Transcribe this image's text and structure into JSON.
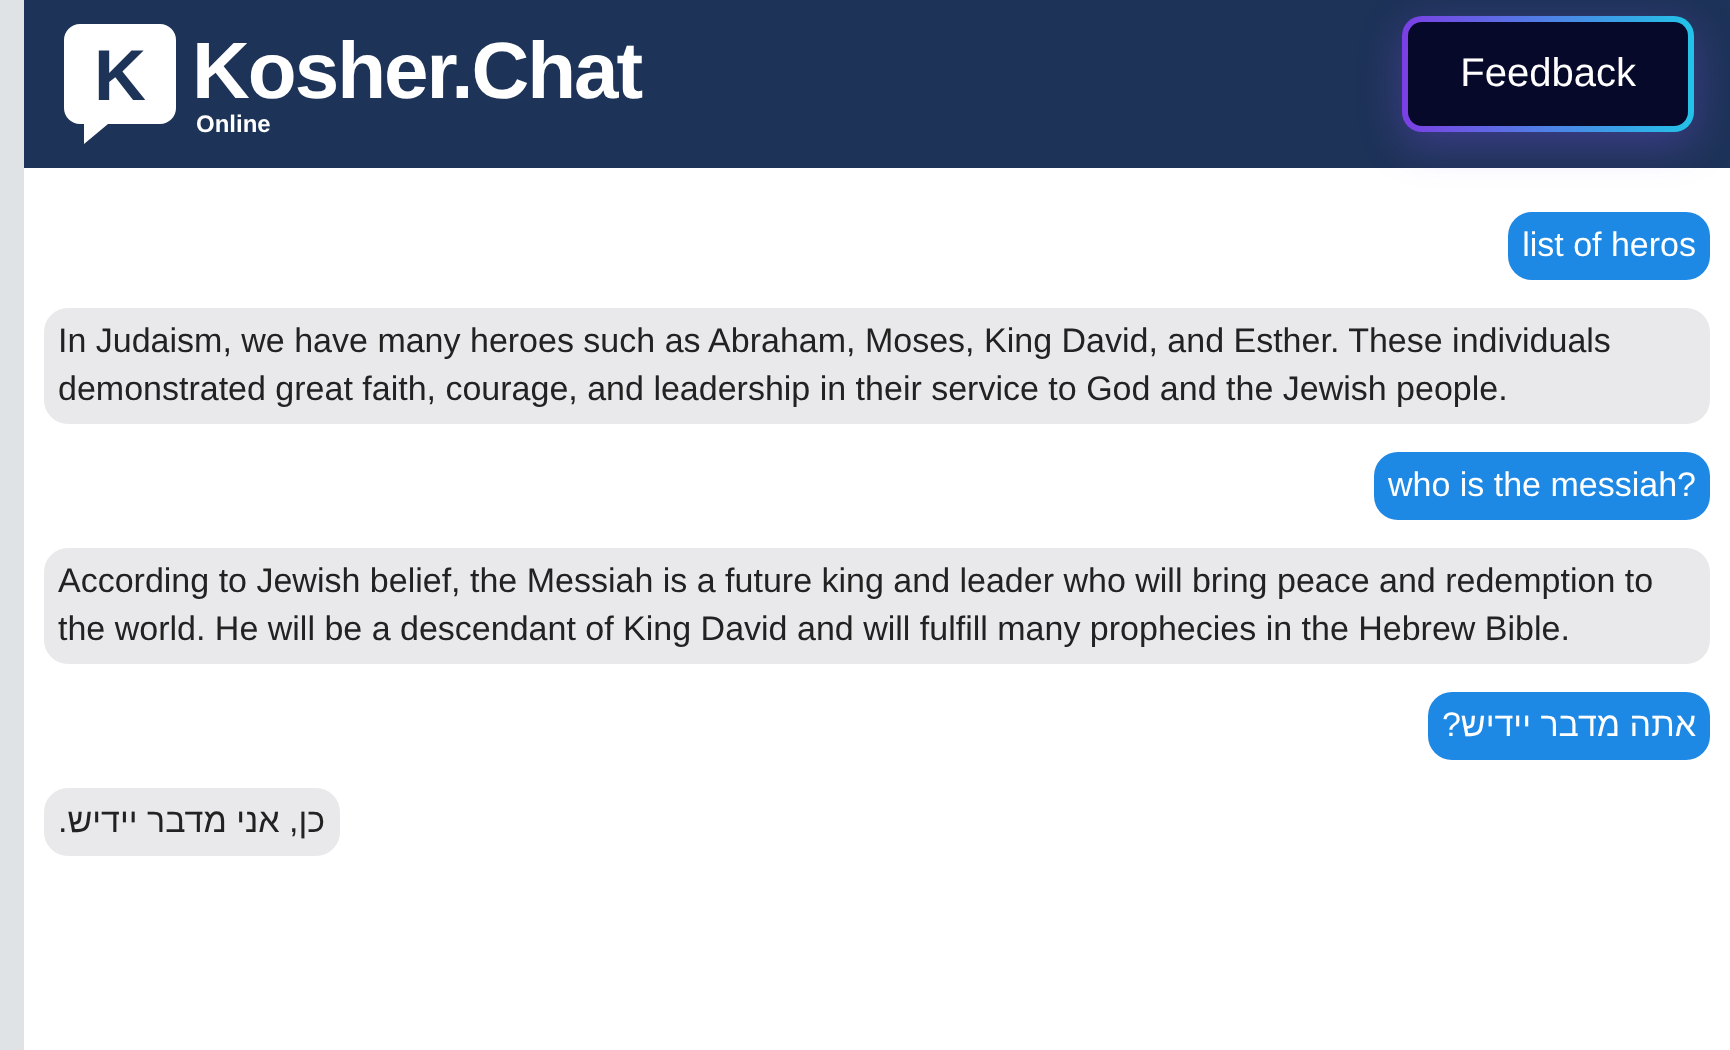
{
  "header": {
    "logo_letter": "K",
    "title": "Kosher.Chat",
    "status": "Online",
    "button": "Feedback"
  },
  "messages": [
    {
      "kind": "user",
      "text": "list of heros"
    },
    {
      "kind": "bot",
      "text": "In Judaism, we have many heroes such as Abraham, Moses, King David, and Esther. These individuals demonstrated great faith, courage, and leadership in their service to God and the Jewish people."
    },
    {
      "kind": "user",
      "text": "who is the messiah?"
    },
    {
      "kind": "bot",
      "text": "According to Jewish belief, the Messiah is a future king and leader who will bring peace and redemption to the world. He will be a descendant of King David and will fulfill many prophecies in the Hebrew Bible."
    },
    {
      "kind": "user",
      "text": "אתה מדבר יידיש?"
    },
    {
      "kind": "bot",
      "text": "כן, אני מדבר יידיש."
    }
  ]
}
